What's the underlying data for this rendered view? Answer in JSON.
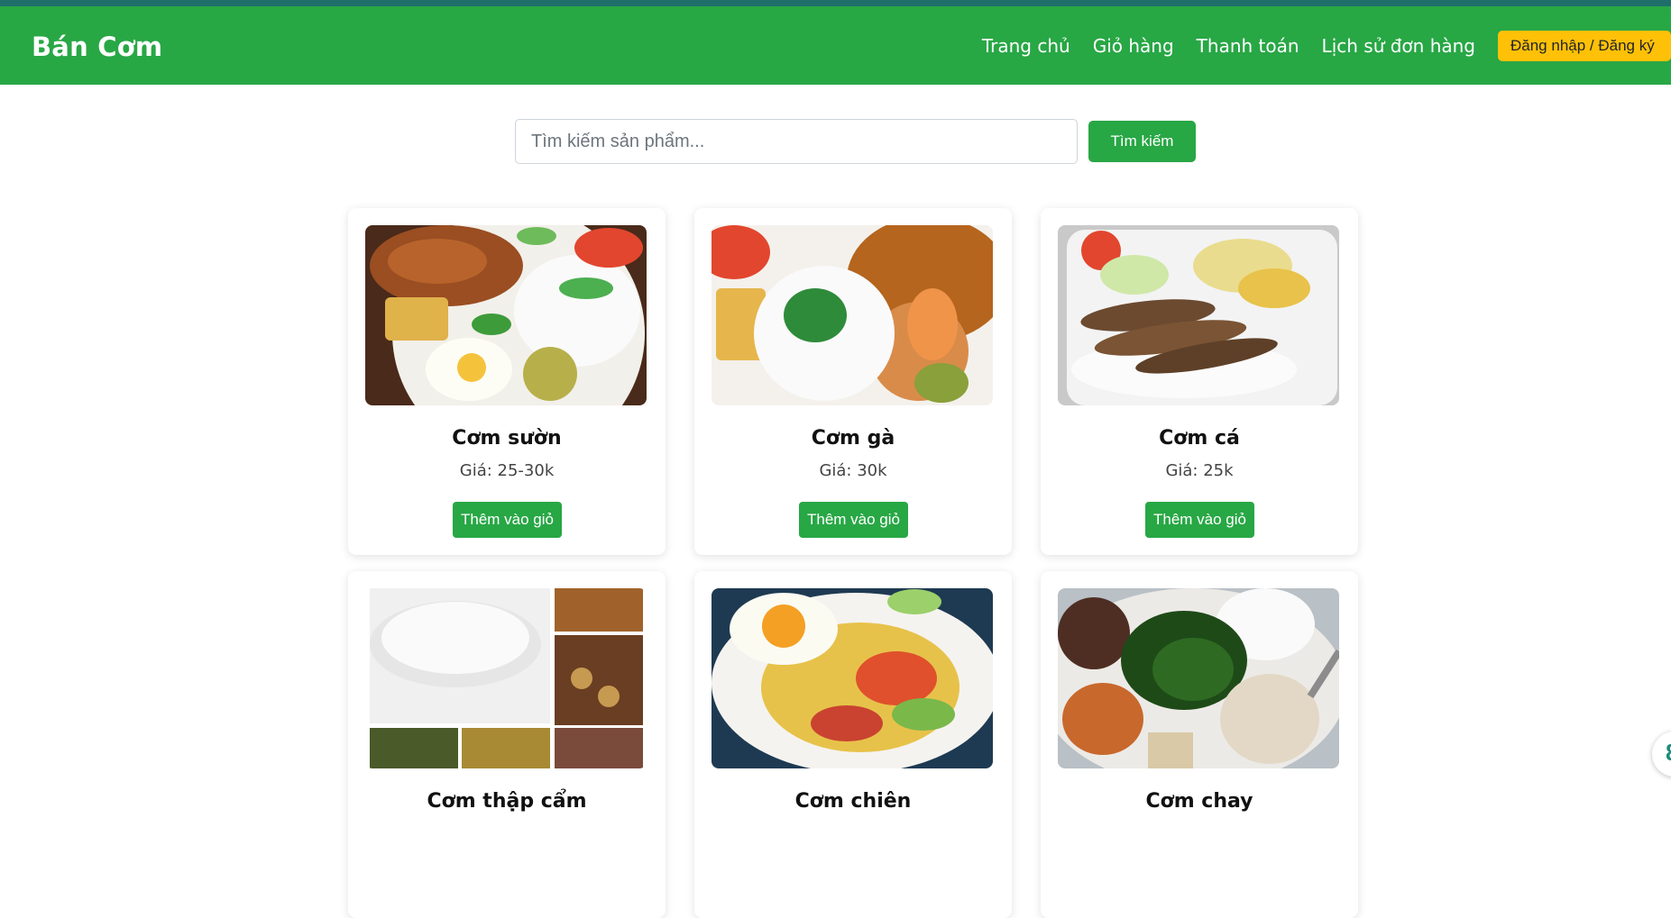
{
  "header": {
    "brand": "Bán Cơm",
    "nav": [
      {
        "label": "Trang chủ",
        "name": "nav-home"
      },
      {
        "label": "Giỏ hàng",
        "name": "nav-cart"
      },
      {
        "label": "Thanh toán",
        "name": "nav-checkout"
      },
      {
        "label": "Lịch sử đơn hàng",
        "name": "nav-order-history"
      }
    ],
    "login_label": "Đăng nhập / Đăng ký"
  },
  "search": {
    "placeholder": "Tìm kiếm sản phẩm...",
    "value": "",
    "button_label": "Tìm kiếm"
  },
  "products": [
    {
      "name": "Cơm sườn",
      "price": "Giá: 25-30k",
      "button": "Thêm vào giỏ"
    },
    {
      "name": "Cơm gà",
      "price": "Giá: 30k",
      "button": "Thêm vào giỏ"
    },
    {
      "name": "Cơm cá",
      "price": "Giá: 25k",
      "button": "Thêm vào giỏ"
    },
    {
      "name": "Cơm thập cẩm",
      "price": "",
      "button": ""
    },
    {
      "name": "Cơm chiên",
      "price": "",
      "button": ""
    },
    {
      "name": "Cơm chay",
      "price": "",
      "button": ""
    }
  ],
  "colors": {
    "primary_green": "#28a745",
    "top_strip": "#1f6e6a",
    "login_yellow": "#ffc107"
  }
}
